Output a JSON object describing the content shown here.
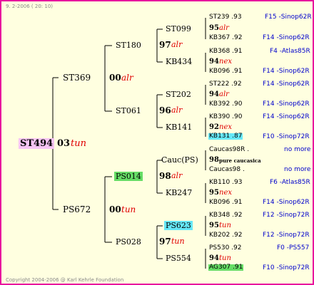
{
  "header": {
    "date_line": "9.  2-2006 ( 20: 10)"
  },
  "footer": {
    "copyright": "Copyright 2004-2006 @ Karl Kehrle Foundation"
  },
  "colors": {
    "border": "#e8129e",
    "background": "#ffffe0",
    "red_text": "#e00000",
    "blue_text": "#0000cc",
    "highlight_green": "#66dd66",
    "highlight_cyan": "#66e8f8",
    "highlight_magenta": "#f7c5f4"
  },
  "pedigree": {
    "root": {
      "id": "ST494",
      "year": "03",
      "race": "tun"
    },
    "gen1": [
      {
        "id": "ST369",
        "year": "00",
        "race": "alr"
      },
      {
        "id": "PS672",
        "year": "00",
        "race": "tun"
      }
    ],
    "gen2": [
      {
        "id": "ST180",
        "year": "97",
        "race": "alr"
      },
      {
        "id": "ST061",
        "year": "96",
        "race": "alr"
      },
      {
        "id": "PS014",
        "year": "98",
        "race": "alr"
      },
      {
        "id": "PS028",
        "year": "97",
        "race": "tun"
      }
    ],
    "gen3": [
      {
        "id": "ST099"
      },
      {
        "id": "KB434"
      },
      {
        "id": "ST202"
      },
      {
        "id": "KB141"
      },
      {
        "id": "Cauc(PS)"
      },
      {
        "id": "KB247"
      },
      {
        "id": "PS623"
      },
      {
        "id": "PS554"
      }
    ],
    "gen4": [
      {
        "sire": "ST239 .93",
        "year": "95",
        "race": "alr",
        "dam": "KB367 .92",
        "sire_src": "F15 -Sinop62R",
        "dam_src": "F14 -Sinop62R"
      },
      {
        "sire": "KB368 .91",
        "year": "94",
        "race": "nex",
        "dam": "KB096 .91",
        "sire_src": "F4 -Atlas85R",
        "dam_src": "F14 -Sinop62R"
      },
      {
        "sire": "ST222 .92",
        "year": "94",
        "race": "alr",
        "dam": "KB392 .90",
        "sire_src": "F14 -Sinop62R",
        "dam_src": "F14 -Sinop62R"
      },
      {
        "sire": "KB390 .90",
        "year": "92",
        "race": "nex",
        "dam": "KB131 .87",
        "sire_src": "F14 -Sinop62R",
        "dam_src": "F10 -Sinop72R"
      },
      {
        "sire": "Caucas98R .",
        "year": "98",
        "race": "pure caucasica",
        "dam": "Caucas98 .",
        "sire_src": "no more",
        "dam_src": "no more"
      },
      {
        "sire": "KB110 .93",
        "year": "95",
        "race": "nex",
        "dam": "KB096 .91",
        "sire_src": "F6 -Atlas85R",
        "dam_src": "F14 -Sinop62R"
      },
      {
        "sire": "KB348 .92",
        "year": "95",
        "race": "tun",
        "dam": "KB202 .92",
        "sire_src": "F12 -Sinop72R",
        "dam_src": "F12 -Sinop72R"
      },
      {
        "sire": "PS530 .92",
        "year": "94",
        "race": "tun",
        "dam": "AG307 .91",
        "sire_src": "F0 -PS557",
        "dam_src": "F10 -Sinop72R"
      }
    ]
  }
}
